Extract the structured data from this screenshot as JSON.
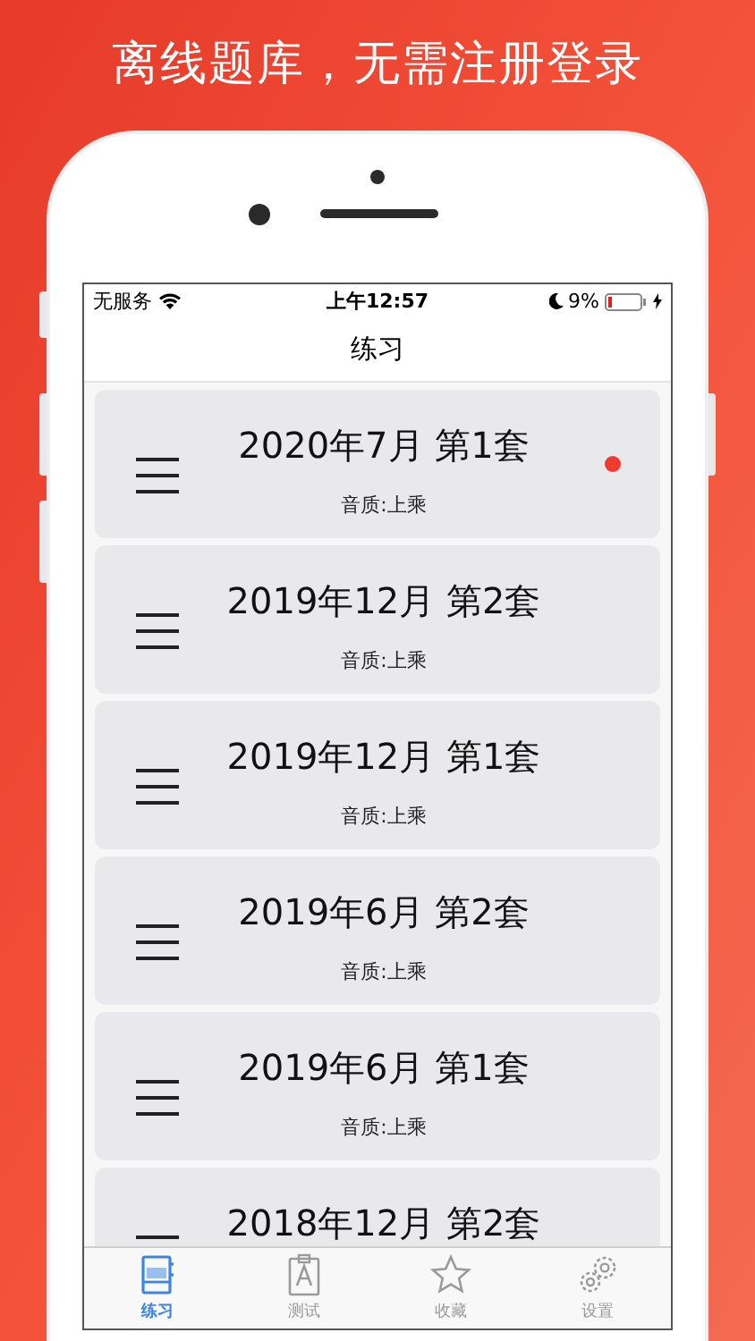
{
  "headline": "离线题库，无需注册登录",
  "status_bar": {
    "carrier": "无服务",
    "time": "上午12:57",
    "battery": "9%"
  },
  "nav": {
    "title": "练习"
  },
  "items": [
    {
      "title": "2020年7月 第1套",
      "subtitle": "音质:上乘",
      "new": true
    },
    {
      "title": "2019年12月 第2套",
      "subtitle": "音质:上乘",
      "new": false
    },
    {
      "title": "2019年12月 第1套",
      "subtitle": "音质:上乘",
      "new": false
    },
    {
      "title": "2019年6月 第2套",
      "subtitle": "音质:上乘",
      "new": false
    },
    {
      "title": "2019年6月 第1套",
      "subtitle": "音质:上乘",
      "new": false
    },
    {
      "title": "2018年12月 第2套",
      "new": false
    }
  ],
  "tabs": [
    {
      "label": "练习",
      "kind": "notebook",
      "selected": true
    },
    {
      "label": "测试",
      "kind": "clipboard",
      "selected": false
    },
    {
      "label": "收藏",
      "kind": "star",
      "selected": false
    },
    {
      "label": "设置",
      "kind": "gear",
      "selected": false
    }
  ]
}
